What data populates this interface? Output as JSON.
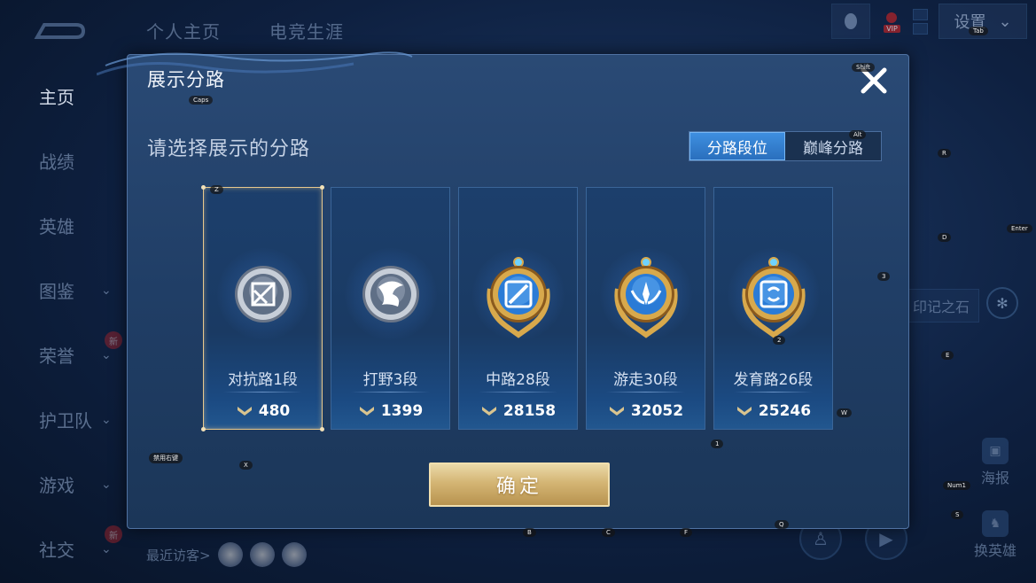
{
  "background": {
    "top_tabs": [
      "个人主页",
      "电竞生涯"
    ],
    "left_nav": [
      {
        "label": "主页",
        "active": true,
        "chevron": false,
        "badge": ""
      },
      {
        "label": "战绩",
        "active": false,
        "chevron": false,
        "badge": ""
      },
      {
        "label": "英雄",
        "active": false,
        "chevron": false,
        "badge": ""
      },
      {
        "label": "图鉴",
        "active": false,
        "chevron": true,
        "badge": ""
      },
      {
        "label": "荣誉",
        "active": false,
        "chevron": true,
        "badge": "新"
      },
      {
        "label": "护卫队",
        "active": false,
        "chevron": true,
        "badge": ""
      },
      {
        "label": "游戏",
        "active": false,
        "chevron": true,
        "badge": ""
      },
      {
        "label": "社交",
        "active": false,
        "chevron": true,
        "badge": "新"
      }
    ],
    "settings_label": "设置",
    "vip_label": "VIP",
    "right_widget_text": "印记之石",
    "side_buttons": [
      "海报",
      "换英雄"
    ],
    "recent_visitors_label": "最近访客>"
  },
  "modal": {
    "title": "展示分路",
    "subtitle": "请选择展示的分路",
    "toggle": {
      "options": [
        "分路段位",
        "巅峰分路"
      ],
      "selected_index": 0
    },
    "cards": [
      {
        "label": "对抗路1段",
        "score": "480",
        "selected": true,
        "emblem": "clash-lane-emblem-silver"
      },
      {
        "label": "打野3段",
        "score": "1399",
        "selected": false,
        "emblem": "jungle-emblem-silver"
      },
      {
        "label": "中路28段",
        "score": "28158",
        "selected": false,
        "emblem": "mid-lane-emblem-gold"
      },
      {
        "label": "游走30段",
        "score": "32052",
        "selected": false,
        "emblem": "roam-emblem-gold"
      },
      {
        "label": "发育路26段",
        "score": "25246",
        "selected": false,
        "emblem": "farm-lane-emblem-gold"
      }
    ],
    "confirm_label": "确定"
  },
  "key_hints": [
    "Tab",
    "Shift",
    "Caps",
    "Alt",
    "R",
    "Z",
    "D",
    "Enter",
    "3",
    "2",
    "E",
    "W",
    "1",
    "X",
    "禁用右键",
    "Num1",
    "S",
    "B",
    "C",
    "F",
    "Q"
  ],
  "colors": {
    "accent_blue": "#2a6fbd",
    "selected_border": "#e7c88d",
    "confirm_gold": "#d4b574",
    "modal_bg": "#203e66"
  }
}
